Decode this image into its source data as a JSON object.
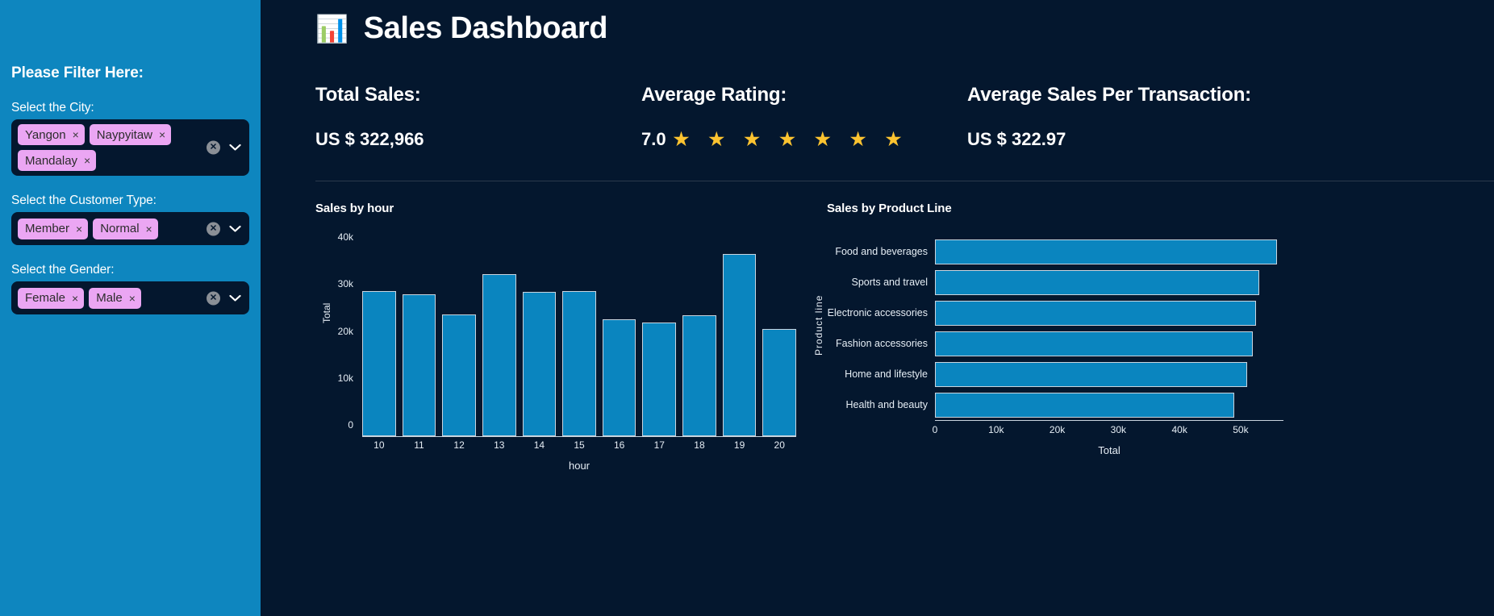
{
  "sidebar": {
    "title": "Please Filter Here:",
    "filters": [
      {
        "label": "Select the City:",
        "name": "city",
        "values": [
          "Yangon",
          "Naypyitaw",
          "Mandalay"
        ]
      },
      {
        "label": "Select the Customer Type:",
        "name": "customer-type",
        "values": [
          "Member",
          "Normal"
        ]
      },
      {
        "label": "Select the Gender:",
        "name": "gender",
        "values": [
          "Female",
          "Male"
        ]
      }
    ],
    "clear_icon": "✕",
    "chevron_icon": "⌄",
    "pill_remove_icon": "×",
    "accent_color": "#0e86bf",
    "pill_color": "#eba6f3"
  },
  "header": {
    "title": "Sales Dashboard",
    "emoji": "📊",
    "emoji_name": "bar-chart-emoji"
  },
  "kpis": [
    {
      "label": "Total Sales:",
      "value": "US $ 322,966",
      "stars": ""
    },
    {
      "label": "Average Rating:",
      "value": "7.0",
      "stars": "★ ★ ★ ★ ★ ★ ★",
      "star_count": 7,
      "star_color": "#fcc330"
    },
    {
      "label": "Average Sales Per Transaction:",
      "value": "US $ 322.97",
      "stars": ""
    }
  ],
  "chart_data": [
    {
      "type": "bar",
      "name": "sales-by-hour",
      "title": "Sales by hour",
      "orientation": "vertical",
      "xlabel": "hour",
      "ylabel": "Total",
      "categories": [
        "10",
        "11",
        "12",
        "13",
        "14",
        "15",
        "16",
        "17",
        "18",
        "19",
        "20"
      ],
      "values": [
        31000,
        30300,
        26000,
        34500,
        30800,
        31000,
        25000,
        24300,
        25800,
        38800,
        22800
      ],
      "ylim": [
        0,
        44000
      ],
      "yticks": [
        0,
        10000,
        20000,
        30000,
        40000
      ],
      "ytick_labels": [
        "0",
        "10k",
        "20k",
        "30k",
        "40k"
      ],
      "grid": false,
      "bar_color": "#0a85bf",
      "bar_edge_color": "#c9d4de"
    },
    {
      "type": "bar",
      "name": "sales-by-product-line",
      "title": "Sales by Product Line",
      "orientation": "horizontal",
      "xlabel": "Total",
      "ylabel": "Product line",
      "categories": [
        "Food and beverages",
        "Sports and travel",
        "Electronic accessories",
        "Fashion accessories",
        "Home and lifestyle",
        "Health and beauty"
      ],
      "values": [
        56000,
        53000,
        52500,
        52000,
        51000,
        49000
      ],
      "xlim": [
        0,
        57000
      ],
      "xticks": [
        0,
        10000,
        20000,
        30000,
        40000,
        50000
      ],
      "xtick_labels": [
        "0",
        "10k",
        "20k",
        "30k",
        "40k",
        "50k"
      ],
      "grid": false,
      "bar_color": "#0a85bf",
      "bar_edge_color": "#c9d4de"
    }
  ]
}
